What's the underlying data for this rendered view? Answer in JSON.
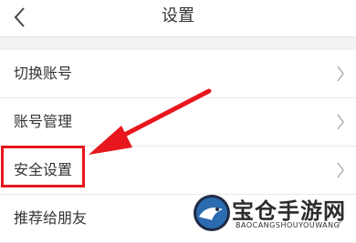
{
  "header": {
    "title": "设置",
    "back_icon": "chevron-left-icon"
  },
  "menu": {
    "items": [
      {
        "label": "切换账号",
        "icon": "chevron-right-icon"
      },
      {
        "label": "账号管理",
        "icon": "chevron-right-icon"
      },
      {
        "label": "安全设置",
        "icon": "chevron-right-icon"
      },
      {
        "label": "推荐给朋友",
        "icon": "chevron-right-icon"
      }
    ]
  },
  "annotation": {
    "highlight_color": "#e8161d",
    "highlighted_item": "安全设置"
  },
  "watermark": {
    "name": "宝仓手游网",
    "subtitle": "BAOCANGSHOUYOUWANG"
  }
}
